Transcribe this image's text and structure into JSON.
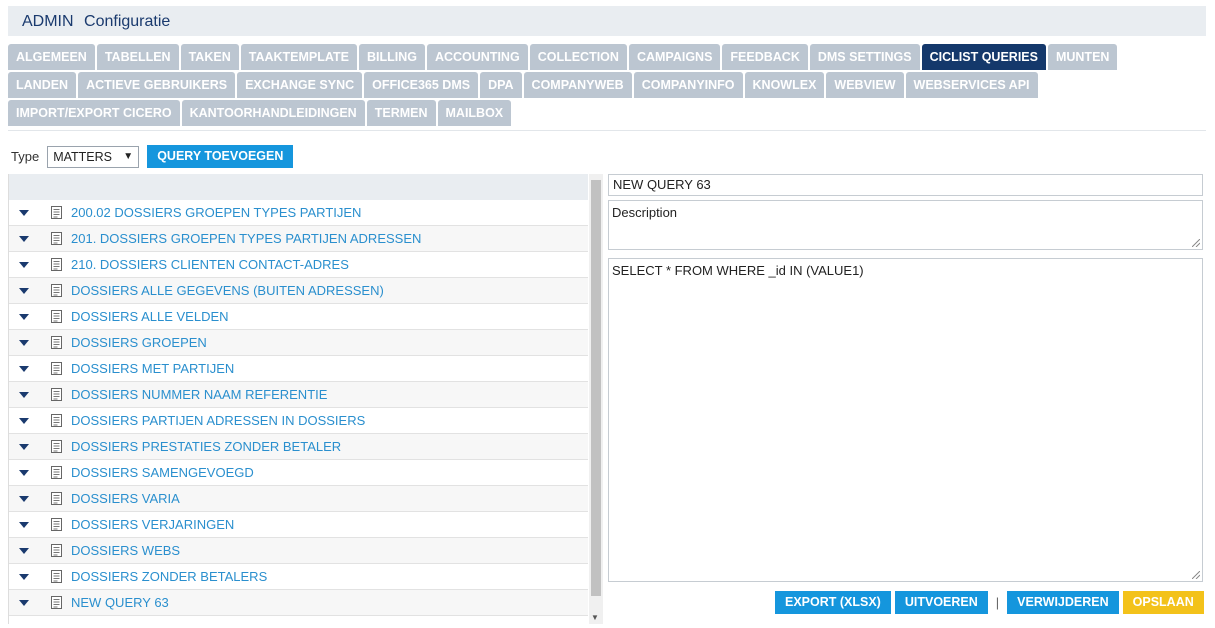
{
  "header": {
    "admin": "ADMIN",
    "title": "Configuratie"
  },
  "tabs": {
    "row1": [
      "ALGEMEEN",
      "TABELLEN",
      "TAKEN",
      "TAAKTEMPLATE",
      "BILLING",
      "ACCOUNTING",
      "COLLECTION",
      "CAMPAIGNS",
      "FEEDBACK",
      "DMS SETTINGS",
      "CICLIST QUERIES",
      "MUNTEN"
    ],
    "row2": [
      "LANDEN",
      "ACTIEVE GEBRUIKERS",
      "EXCHANGE SYNC",
      "OFFICE365 DMS",
      "DPA",
      "COMPANYWEB",
      "COMPANYINFO",
      "KNOWLEX",
      "WEBVIEW",
      "WEBSERVICES API"
    ],
    "row3": [
      "IMPORT/EXPORT CICERO",
      "KANTOORHANDLEIDINGEN",
      "TERMEN",
      "MAILBOX"
    ],
    "active": "CICLIST QUERIES"
  },
  "filter": {
    "type_label": "Type",
    "type_value": "MATTERS",
    "add_button": "QUERY TOEVOEGEN"
  },
  "queries": [
    "200.02 DOSSIERS GROEPEN TYPES PARTIJEN",
    "201. DOSSIERS GROEPEN TYPES PARTIJEN ADRESSEN",
    "210. DOSSIERS CLIENTEN CONTACT-ADRES",
    "DOSSIERS ALLE GEGEVENS (BUITEN ADRESSEN)",
    "DOSSIERS ALLE VELDEN",
    "DOSSIERS GROEPEN",
    "DOSSIERS MET PARTIJEN",
    "DOSSIERS NUMMER NAAM REFERENTIE",
    "DOSSIERS PARTIJEN ADRESSEN IN DOSSIERS",
    "DOSSIERS PRESTATIES ZONDER BETALER",
    "DOSSIERS SAMENGEVOEGD",
    "DOSSIERS VARIA",
    "DOSSIERS VERJARINGEN",
    "DOSSIERS WEBS",
    "DOSSIERS ZONDER BETALERS",
    "NEW QUERY 63"
  ],
  "editor": {
    "name": "NEW QUERY 63",
    "description": "Description",
    "sql": "SELECT * FROM WHERE _id IN (VALUE1)"
  },
  "actions": {
    "export": "EXPORT (XLSX)",
    "run": "UITVOEREN",
    "separator": "|",
    "delete": "VERWIJDEREN",
    "save": "OPSLAAN"
  },
  "colors": {
    "accent": "#1596dd",
    "active_tab": "#14386b",
    "save": "#f3c21a",
    "link": "#2a8fce"
  }
}
